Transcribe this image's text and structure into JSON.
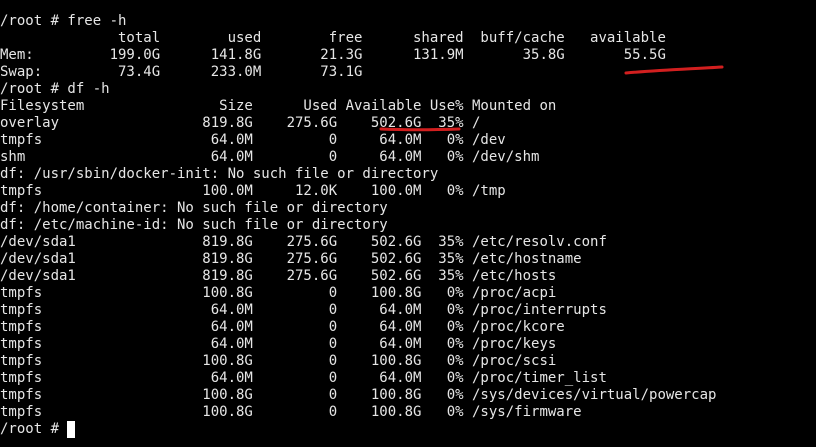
{
  "colors": {
    "background": "#000000",
    "text": "#e6e6e6",
    "annotation": "#d21f1f"
  },
  "terminal": {
    "lines": [
      "/root # free -h",
      "              total        used        free      shared  buff/cache   available",
      "Mem:         199.0G      141.8G       21.3G      131.9M       35.8G       55.5G",
      "Swap:         73.4G      233.0M       73.1G",
      "/root # df -h",
      "Filesystem                Size      Used Available Use% Mounted on",
      "overlay                 819.8G    275.6G    502.6G  35% /",
      "tmpfs                    64.0M         0     64.0M   0% /dev",
      "shm                      64.0M         0     64.0M   0% /dev/shm",
      "df: /usr/sbin/docker-init: No such file or directory",
      "tmpfs                   100.0M     12.0K    100.0M   0% /tmp",
      "df: /home/container: No such file or directory",
      "df: /etc/machine-id: No such file or directory",
      "/dev/sda1               819.8G    275.6G    502.6G  35% /etc/resolv.conf",
      "/dev/sda1               819.8G    275.6G    502.6G  35% /etc/hostname",
      "/dev/sda1               819.8G    275.6G    502.6G  35% /etc/hosts",
      "tmpfs                   100.8G         0    100.8G   0% /proc/acpi",
      "tmpfs                    64.0M         0     64.0M   0% /proc/interrupts",
      "tmpfs                    64.0M         0     64.0M   0% /proc/kcore",
      "tmpfs                    64.0M         0     64.0M   0% /proc/keys",
      "tmpfs                   100.8G         0    100.8G   0% /proc/scsi",
      "tmpfs                    64.0M         0     64.0M   0% /proc/timer_list",
      "tmpfs                   100.8G         0    100.8G   0% /sys/devices/virtual/powercap",
      "tmpfs                   100.8G         0    100.8G   0% /sys/firmware"
    ],
    "prompt": "/root # "
  }
}
